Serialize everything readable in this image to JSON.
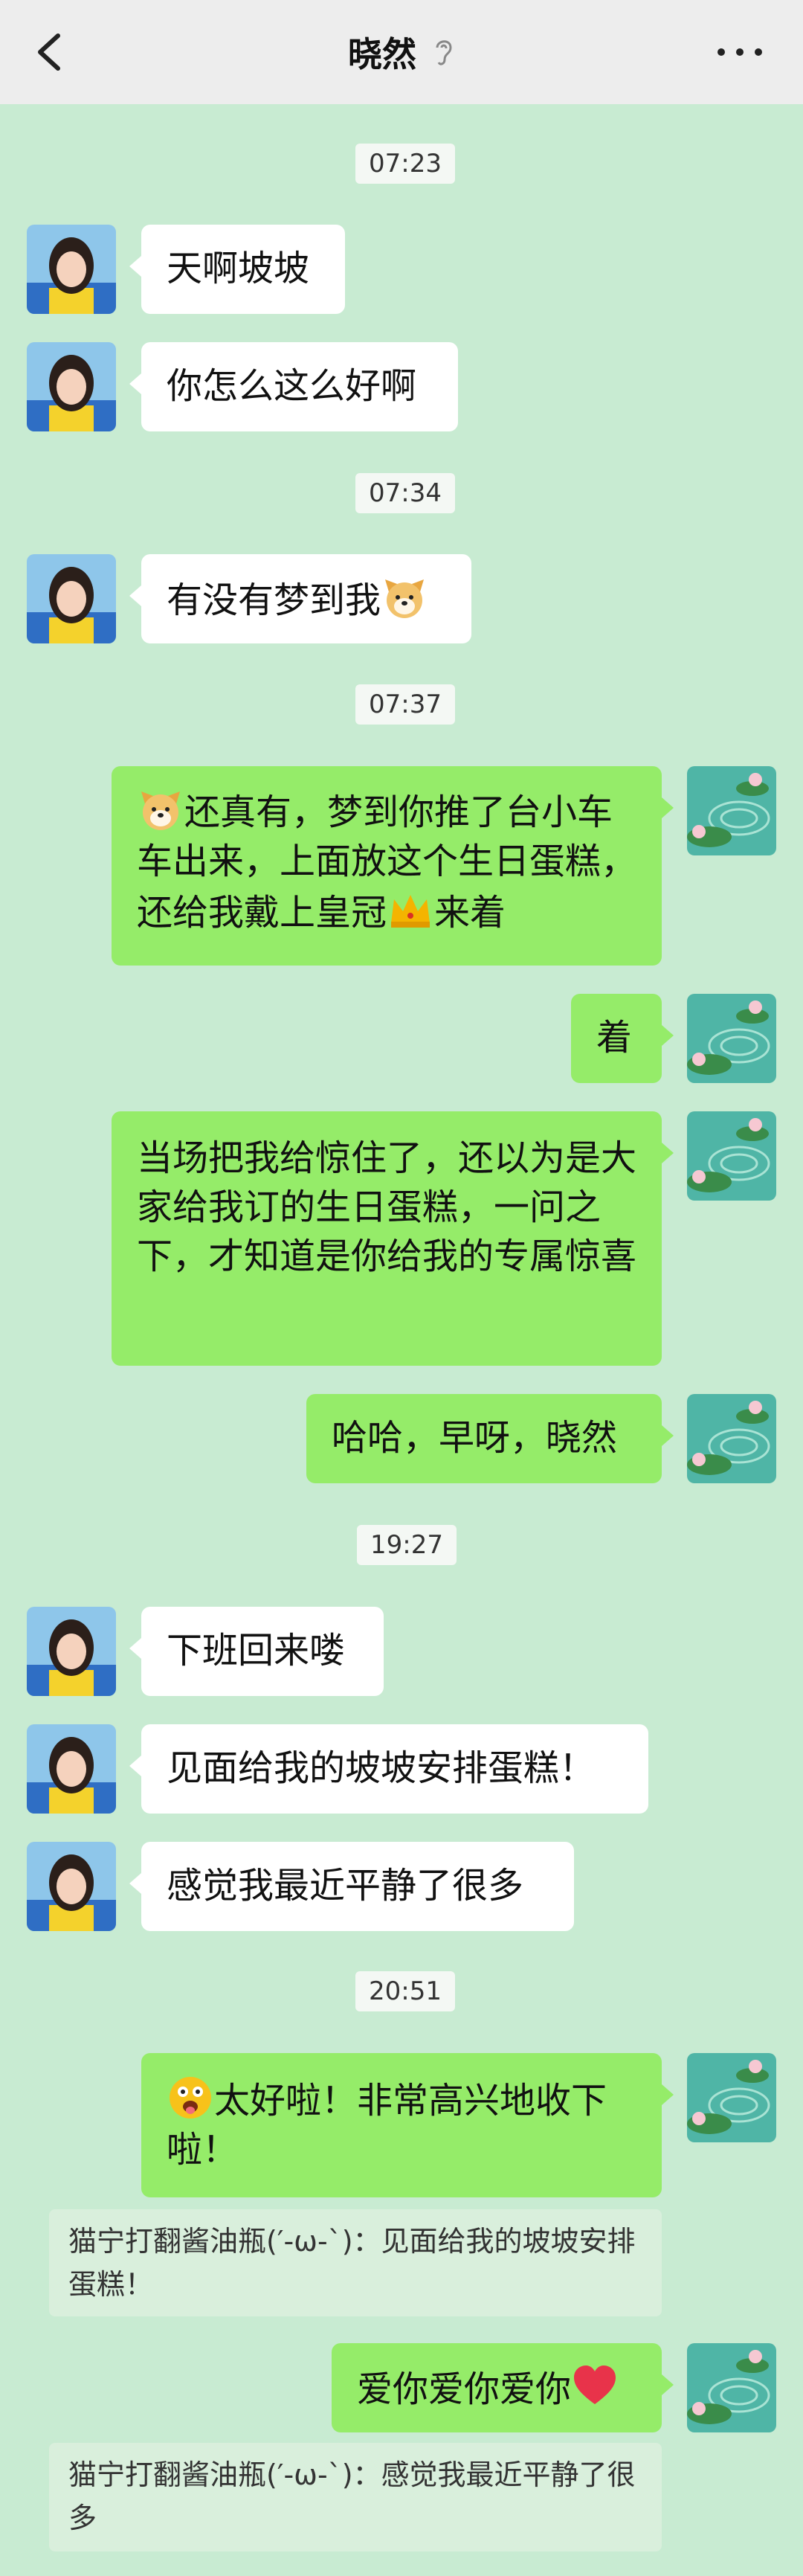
{
  "header": {
    "title": "晓然",
    "back_icon": "chevron-left-icon",
    "ear_icon": "ear-icon",
    "more_icon": "more-dots-icon"
  },
  "colors": {
    "background": "#c8ebd2",
    "incoming_bubble": "#ffffff",
    "outgoing_bubble": "#95ec69",
    "topbar": "#ededed"
  },
  "messages": {
    "t1": "07:23",
    "m1": "天啊坡坡",
    "m2": "你怎么这么好啊",
    "t2": "07:34",
    "m3": "有没有梦到我",
    "t3": "07:37",
    "m4": "还真有，梦到你推了台小车车出来，上面放这个生日蛋糕，还给我戴上皇冠",
    "m4_tail": "来着",
    "m5": "着",
    "m6": "当场把我给惊住了，还以为是大家给我订的生日蛋糕，一问之下，才知道是你给我的专属惊喜",
    "m7": "哈哈，早呀，晓然",
    "t4": "19:27",
    "m8": "下班回来喽",
    "m9": "见面给我的坡坡安排蛋糕！",
    "m10": "感觉我最近平静了很多",
    "t5": "20:51",
    "m11": "太好啦！非常高兴地收下啦！",
    "q1": "猫宁打翻酱油瓶(′-ω-`)：见面给我的坡坡安排蛋糕！",
    "m12": "爱你爱你爱你",
    "q2": "猫宁打翻酱油瓶(′-ω-`)：感觉我最近平静了很多"
  }
}
